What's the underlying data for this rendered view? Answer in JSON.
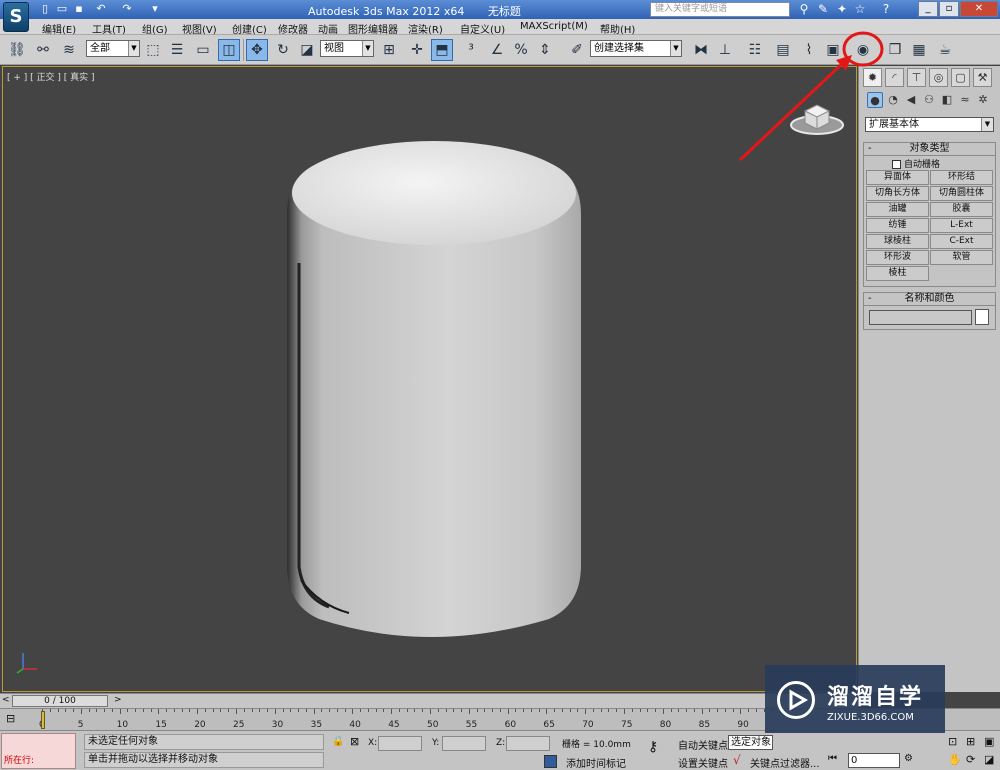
{
  "title_bar": {
    "app_name": "Autodesk 3ds Max  2012 x64",
    "doc_name": "无标题",
    "search_placeholder": "键入关键字或短语",
    "help_label": "?"
  },
  "menu": [
    "编辑(E)",
    "工具(T)",
    "组(G)",
    "视图(V)",
    "创建(C)",
    "修改器",
    "动画",
    "图形编辑器",
    "渲染(R)",
    "自定义(U)",
    "MAXScript(M)",
    "帮助(H)"
  ],
  "toolbar": {
    "selection_filter": "全部",
    "reference_coord": "视图",
    "named_selection": "创建选择集"
  },
  "viewport": {
    "label": "[ + ] [ 正交 ] [ 真实 ]"
  },
  "command_panel": {
    "category": "扩展基本体",
    "object_type_title": "对象类型",
    "autogrid_label": "自动栅格",
    "object_buttons": [
      "异面体",
      "环形结",
      "切角长方体",
      "切角圆柱体",
      "油罐",
      "胶囊",
      "纺锤",
      "L-Ext",
      "球棱柱",
      "C-Ext",
      "环形波",
      "软管",
      "棱柱"
    ],
    "name_color_title": "名称和颜色",
    "collapse_symbol": "-"
  },
  "timeline": {
    "frame_display": "0 / 100",
    "ticks": [
      "0",
      "5",
      "10",
      "15",
      "20",
      "25",
      "30",
      "35",
      "40",
      "45",
      "50",
      "55",
      "60",
      "65",
      "70",
      "75",
      "80",
      "85",
      "90"
    ]
  },
  "status_bar": {
    "listener_text": "所在行:",
    "status_line1": "未选定任何对象",
    "status_line2": "单击并拖动以选择并移动对象",
    "x_label": "X:",
    "y_label": "Y:",
    "z_label": "Z:",
    "grid_text": "栅格 = 10.0mm",
    "add_time_tag": "添加时间标记",
    "auto_key": "自动关键点",
    "set_key": "设置关键点",
    "selected_option": "选定对象",
    "key_filters": "关键点过滤器...",
    "current_frame": "0"
  },
  "watermark": {
    "title": "溜溜自学",
    "subtitle": "ZIXUE.3D66.COM"
  }
}
